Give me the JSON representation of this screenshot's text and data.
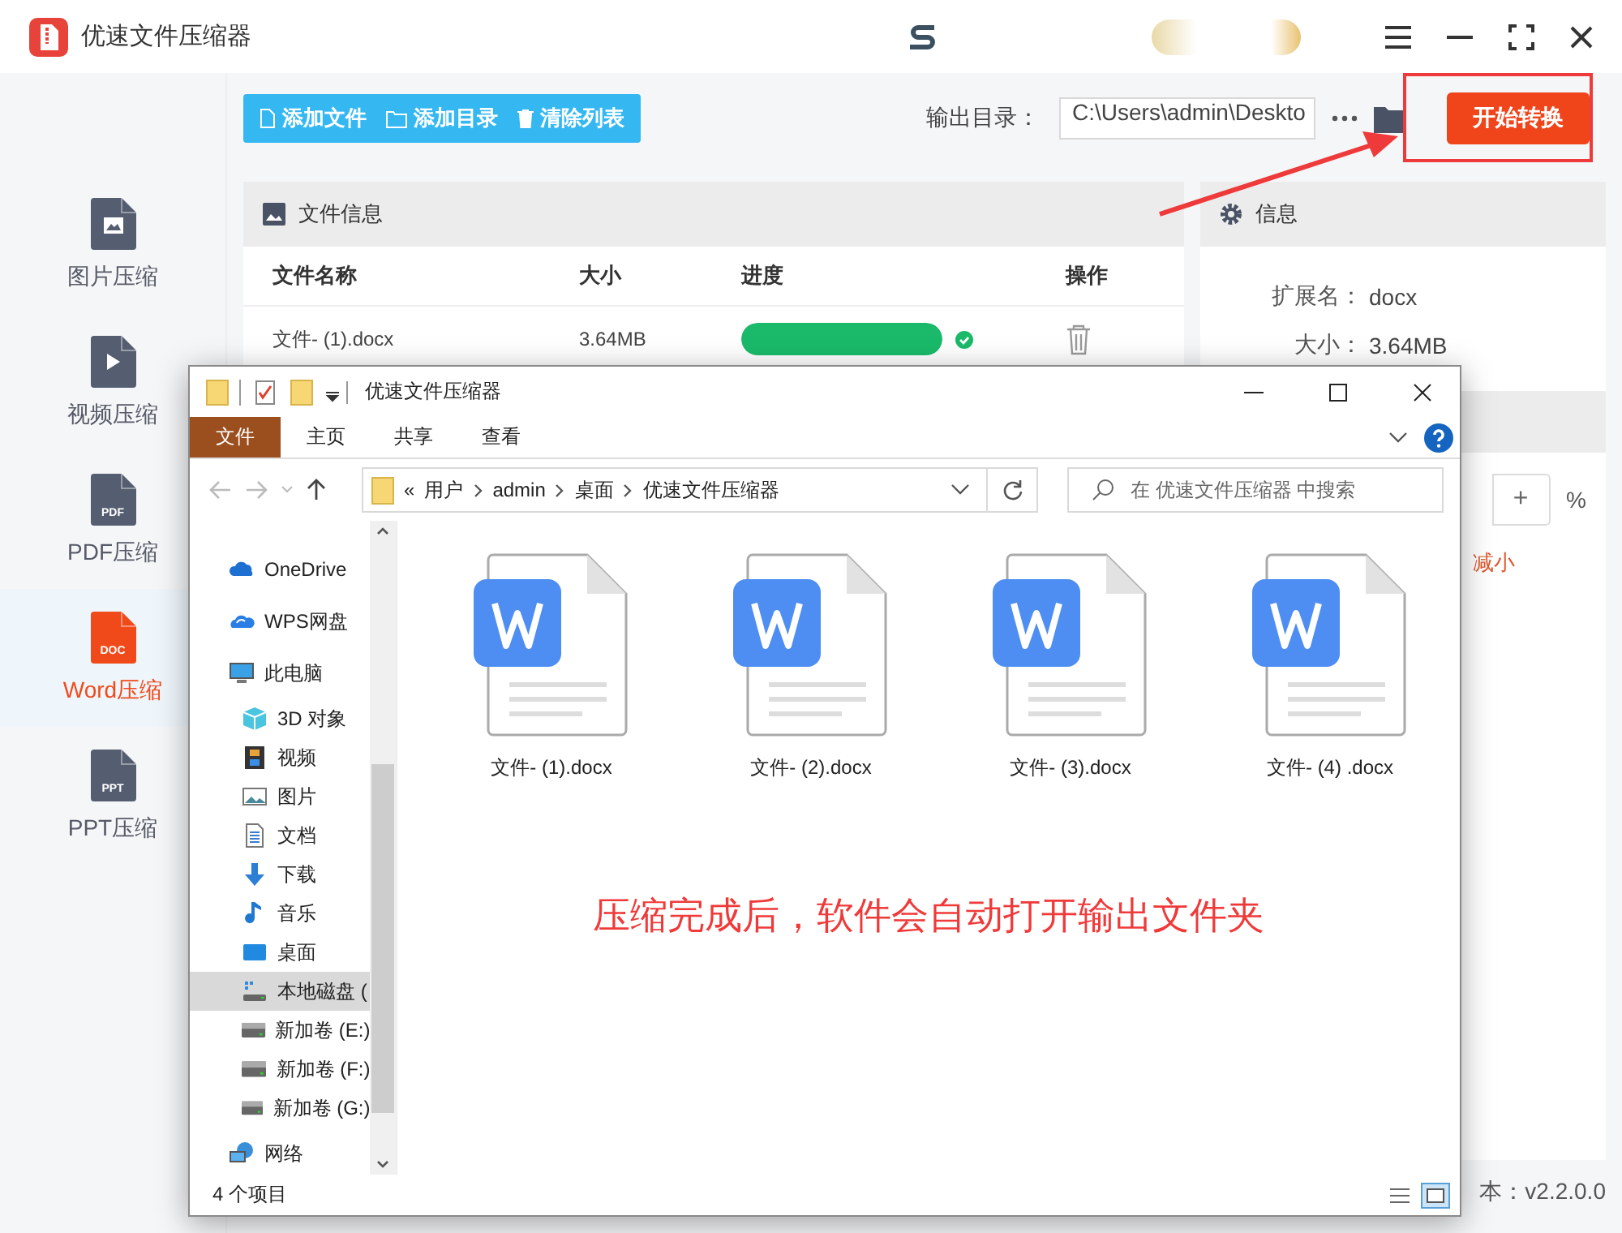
{
  "app": {
    "title": "优速文件压缩器"
  },
  "sidebar": {
    "items": [
      {
        "label": "图片压缩",
        "kind": "image",
        "selected": false
      },
      {
        "label": "视频压缩",
        "kind": "video",
        "selected": false
      },
      {
        "label": "PDF压缩",
        "kind": "badge",
        "badge": "PDF",
        "selected": false
      },
      {
        "label": "Word压缩",
        "kind": "badge",
        "badge": "DOC",
        "selected": true
      },
      {
        "label": "PPT压缩",
        "kind": "badge",
        "badge": "PPT",
        "selected": false
      }
    ]
  },
  "toolbar": {
    "buttons": [
      {
        "label": "添加文件",
        "kind": "file"
      },
      {
        "label": "添加目录",
        "kind": "folder"
      },
      {
        "label": "清除列表",
        "kind": "trash"
      }
    ],
    "output_label": "输出目录：",
    "output_path": "C:\\Users\\admin\\Deskto",
    "start_button": "开始转换"
  },
  "file_panel": {
    "title": "文件信息",
    "columns": [
      "文件名称",
      "大小",
      "进度",
      "操作"
    ],
    "rows": [
      {
        "name": "文件- (1).docx",
        "size": "3.64MB",
        "level": 1,
        "done": true
      }
    ]
  },
  "info_panel": {
    "title": "信息",
    "fields": [
      {
        "label": "扩展名：",
        "value": "docx"
      },
      {
        "label": "大小：",
        "value": "3.64MB"
      }
    ],
    "stepper_plus": "+",
    "unit": "%",
    "hint": "减小"
  },
  "version": "本：v2.2.0.0",
  "explorer": {
    "title": "优速文件压缩器",
    "ribbon_tabs": [
      {
        "label": "文件",
        "selected": true
      },
      {
        "label": "主页",
        "selected": false
      },
      {
        "label": "共享",
        "selected": false
      },
      {
        "label": "查看",
        "selected": false
      }
    ],
    "breadcrumb_prefix": "«",
    "breadcrumb": [
      "用户",
      "admin",
      "桌面",
      "优速文件压缩器"
    ],
    "search_placeholder": "在 优速文件压缩器 中搜索",
    "nav": [
      {
        "label": "OneDrive",
        "kind": "cloud",
        "selected": false
      },
      {
        "label": "WPS网盘",
        "kind": "cloud2",
        "selected": false
      },
      {
        "label": "此电脑",
        "kind": "pc",
        "selected": false,
        "children": [
          {
            "label": "3D 对象",
            "kind": "cube",
            "selected": false
          },
          {
            "label": "视频",
            "kind": "film",
            "selected": false
          },
          {
            "label": "图片",
            "kind": "photo",
            "selected": false
          },
          {
            "label": "文档",
            "kind": "doc",
            "selected": false
          },
          {
            "label": "下载",
            "kind": "download",
            "selected": false
          },
          {
            "label": "音乐",
            "kind": "music",
            "selected": false
          },
          {
            "label": "桌面",
            "kind": "desktop",
            "selected": false
          },
          {
            "label": "本地磁盘 (",
            "kind": "sysdrive",
            "selected": true
          },
          {
            "label": "新加卷 (E:)",
            "kind": "drive",
            "selected": false
          },
          {
            "label": "新加卷 (F:)",
            "kind": "drive",
            "selected": false
          },
          {
            "label": "新加卷 (G:)",
            "kind": "drive",
            "selected": false
          }
        ]
      },
      {
        "label": "网络",
        "kind": "network",
        "selected": false
      }
    ],
    "files": [
      {
        "name": "文件- (1).docx"
      },
      {
        "name": "文件- (2).docx"
      },
      {
        "name": "文件- (3).docx"
      },
      {
        "name": "文件- (4) .docx"
      }
    ],
    "message": "压缩完成后，软件会自动打开输出文件夹",
    "status": "4 个项目"
  }
}
